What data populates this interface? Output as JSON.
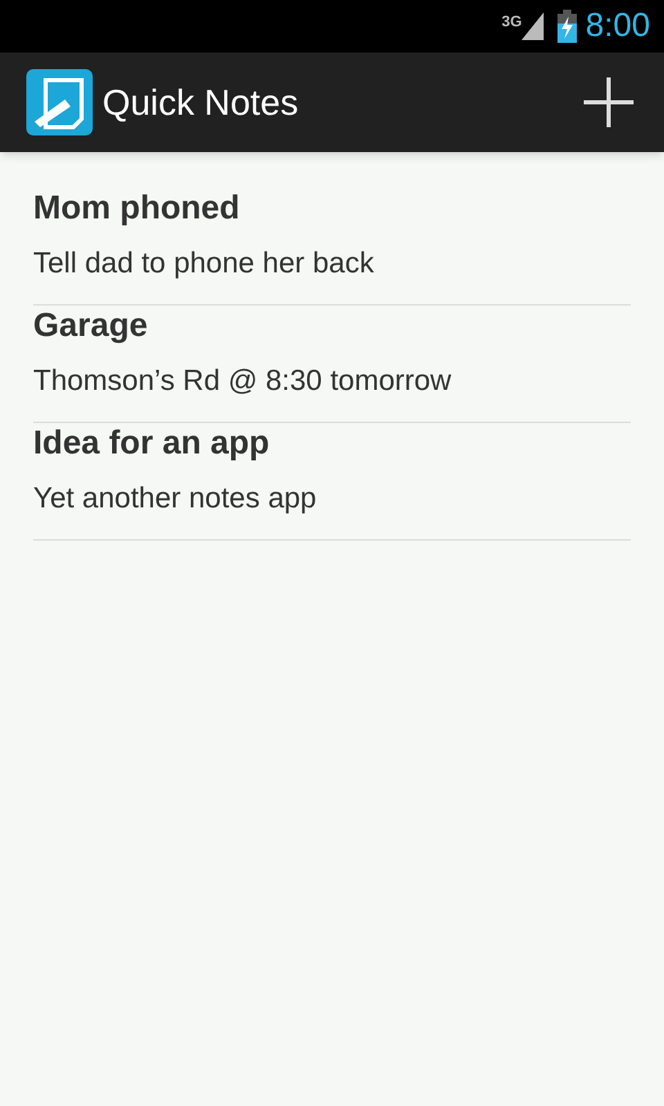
{
  "status_bar": {
    "network": "3G",
    "time": "8:00"
  },
  "action_bar": {
    "title": "Quick Notes"
  },
  "notes": [
    {
      "title": "Mom phoned",
      "body": "Tell dad to phone her back"
    },
    {
      "title": "Garage",
      "body": "Thomson’s Rd @ 8:30 tomorrow"
    },
    {
      "title": "Idea for an app",
      "body": "Yet another notes app"
    }
  ]
}
